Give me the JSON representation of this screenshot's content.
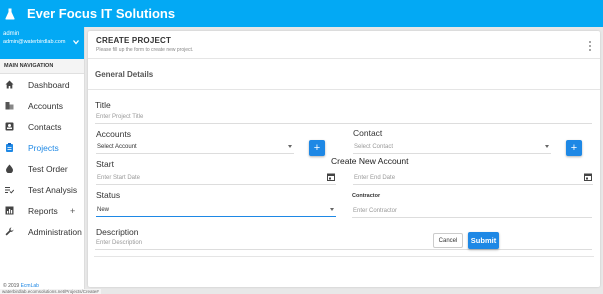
{
  "app": {
    "title": "Ever Focus IT Solutions",
    "logo_icon": "flask-icon"
  },
  "colors": {
    "accent": "#03a9f4",
    "primary_button": "#1e88e5"
  },
  "user": {
    "name": "admin",
    "email": "admin@waterbirdlab.com"
  },
  "nav": {
    "header": "MAIN NAVIGATION",
    "items": [
      {
        "label": "Dashboard",
        "icon": "home-icon"
      },
      {
        "label": "Accounts",
        "icon": "building-icon"
      },
      {
        "label": "Contacts",
        "icon": "contact-card-icon"
      },
      {
        "label": "Projects",
        "icon": "clipboard-icon",
        "active": true
      },
      {
        "label": "Test Order",
        "icon": "drop-icon"
      },
      {
        "label": "Test Analysis",
        "icon": "list-check-icon"
      },
      {
        "label": "Reports",
        "icon": "chart-icon",
        "expand": "+"
      },
      {
        "label": "Administration",
        "icon": "wrench-icon"
      }
    ]
  },
  "footer": {
    "copyright": "© 2019",
    "brand": "EcmLab"
  },
  "form": {
    "title": "CREATE PROJECT",
    "subtitle": "Please fill up the form to create new project.",
    "section": "General Details",
    "title_label": "Title",
    "title_placeholder": "Enter Project Title",
    "accounts_label": "Accounts",
    "accounts_placeholder": "Select Account",
    "contact_label": "Contact",
    "contact_placeholder": "Select Contact",
    "add_symbol": "+",
    "tooltip": "Create New Account",
    "start_label": "Start",
    "start_placeholder": "Enter Start Date",
    "end_placeholder": "Enter End Date",
    "status_label": "Status",
    "status_value": "New",
    "contractor_label": "Contractor",
    "contractor_placeholder": "Enter Contractor",
    "description_label": "Description",
    "description_placeholder": "Enter Description",
    "cancel_label": "Cancel",
    "submit_label": "Submit"
  },
  "statusbar": "waterbirdlab.ecomsolutions.net/Projects/Create#"
}
